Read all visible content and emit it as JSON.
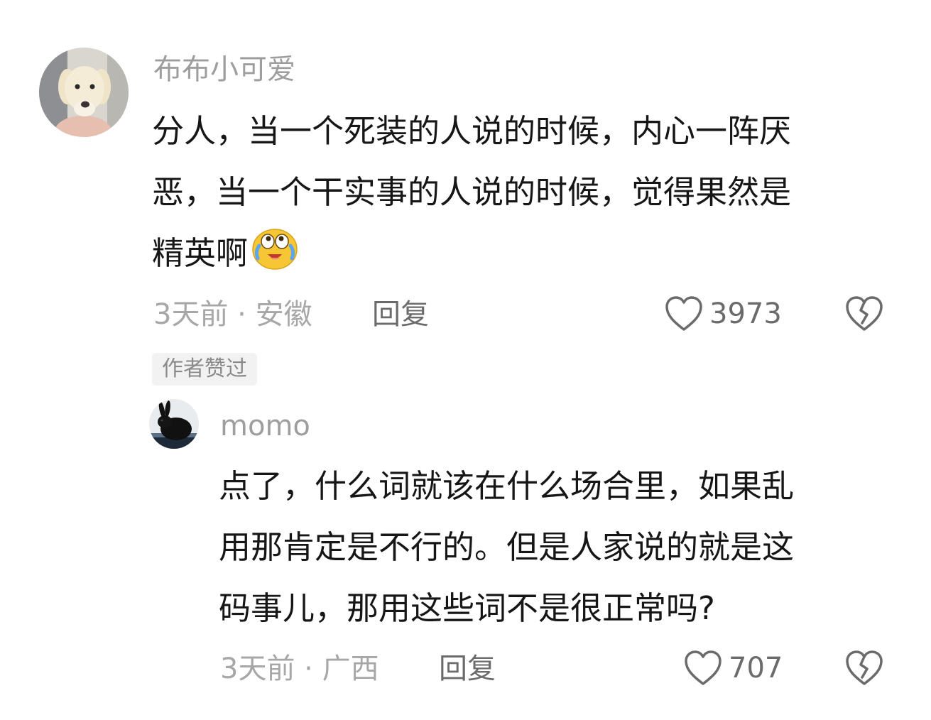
{
  "comments": [
    {
      "username": "布布小可爱",
      "text_lines": [
        "分人，当一个死装的人说的时候，内心一阵厌",
        "恶，当一个干实事的人说的时候，觉得果然是",
        "精英啊"
      ],
      "emoji": "laugh-cry-emoji",
      "time_location": "3天前 · 安徽",
      "reply_label": "回复",
      "likes": "3973",
      "badge": "作者赞过",
      "avatar": "puppy-avatar"
    },
    {
      "username": "momo",
      "text_lines": [
        "点了，什么词就该在什么场合里，如果乱",
        "用那肯定是不行的。但是人家说的就是这",
        "码事儿，那用这些词不是很正常吗?"
      ],
      "time_location": "3天前 · 广西",
      "reply_label": "回复",
      "likes": "707",
      "avatar": "rabbit-avatar"
    }
  ]
}
